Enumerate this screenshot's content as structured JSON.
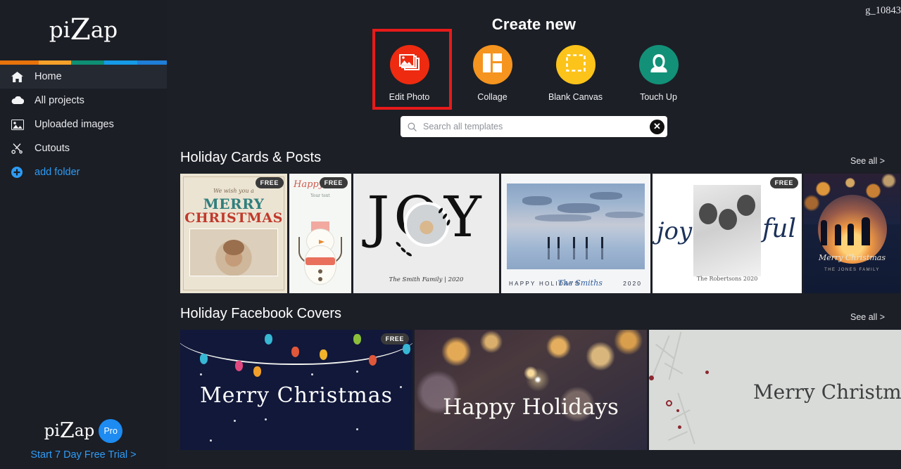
{
  "sidebar": {
    "logo": {
      "pre": "pi",
      "mid": "Z",
      "post": "ap"
    },
    "accent_bar": [
      "#e8730c",
      "#f6a12a",
      "#0e8f73",
      "#159ae8",
      "#1f7ed8"
    ],
    "items": [
      {
        "label": "Home",
        "icon": "home-icon",
        "active": true
      },
      {
        "label": "All projects",
        "icon": "cloud-icon",
        "active": false
      },
      {
        "label": "Uploaded images",
        "icon": "image-icon",
        "active": false
      },
      {
        "label": "Cutouts",
        "icon": "scissors-icon",
        "active": false
      },
      {
        "label": "add folder",
        "icon": "plus-circle-icon",
        "active": false
      }
    ],
    "pro": {
      "logo_pre": "pi",
      "logo_mid": "Z",
      "logo_post": "ap",
      "badge": "Pro",
      "trial_label": "Start 7 Day Free Trial >",
      "badge_color": "#1d8bf1",
      "link_color": "#2f9df7"
    }
  },
  "header": {
    "account": "g_10843",
    "create_title": "Create new"
  },
  "actions": [
    {
      "label": "Edit Photo",
      "icon": "photos-icon",
      "color": "#ee2b10",
      "highlighted": true
    },
    {
      "label": "Collage",
      "icon": "collage-grid-icon",
      "color": "#f5941e",
      "highlighted": false
    },
    {
      "label": "Blank Canvas",
      "icon": "dashed-square-icon",
      "color": "#fcc31a",
      "highlighted": false
    },
    {
      "label": "Touch Up",
      "icon": "face-icon",
      "color": "#129178",
      "highlighted": false
    }
  ],
  "search": {
    "placeholder": "Search all templates",
    "value": "",
    "icon": "search-icon",
    "clear_icon": "clear-circle-icon",
    "clear_glyph": "✕"
  },
  "sections": [
    {
      "title": "Holiday Cards & Posts",
      "see_all": "See all >",
      "cards": [
        {
          "name": "merry-christmas-baby",
          "free": true,
          "texts": {
            "wish": "We wish you a",
            "merry": "MERRY",
            "christmas": "CHRISTMAS"
          }
        },
        {
          "name": "snowman-happy-holidays",
          "free": true,
          "texts": {
            "happy": "Happy H",
            "sub": "Your text"
          }
        },
        {
          "name": "joy-photo-wreath",
          "free": false,
          "texts": {
            "joy": "JOY",
            "family": "The Smith Family | 2020"
          }
        },
        {
          "name": "beach-happy-holidays",
          "free": false,
          "texts": {
            "greeting": "HAPPY HOLIDAYS",
            "family": "The Smiths",
            "year": "2020"
          }
        },
        {
          "name": "joyful-family-photo",
          "free": true,
          "texts": {
            "joy": "joy",
            "ful": "ful",
            "family": "The Robertsons 2020"
          }
        },
        {
          "name": "silhouette-merry-christmas",
          "free": false,
          "texts": {
            "merry": "Merry Christmas",
            "family": "THE JONES FAMILY"
          }
        }
      ]
    },
    {
      "title": "Holiday Facebook Covers",
      "see_all": "See all >",
      "cards": [
        {
          "name": "string-lights-merry-christmas",
          "free": true,
          "texts": {
            "title": "Merry Christmas"
          }
        },
        {
          "name": "bokeh-happy-holidays",
          "free": false,
          "texts": {
            "title": "Happy Holidays"
          }
        },
        {
          "name": "botanical-merry-christmas",
          "free": false,
          "texts": {
            "title": "Merry Christm"
          }
        }
      ]
    }
  ],
  "badges": {
    "free": "FREE"
  }
}
